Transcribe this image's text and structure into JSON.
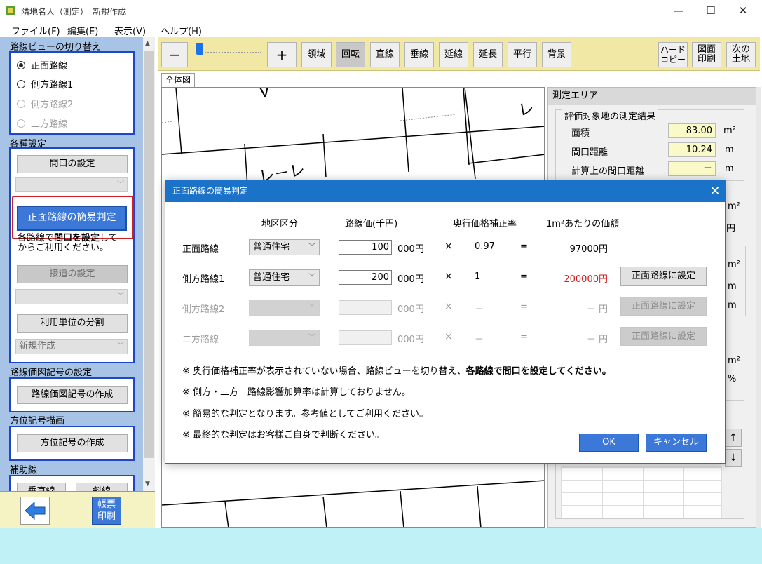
{
  "window": {
    "title": "隣地名人（測定）　新規作成",
    "minimize_icon": "—",
    "maximize_icon": "☐",
    "close_icon": "✕"
  },
  "menu": [
    "ファイル(F)",
    "編集(E)",
    "表示(V)",
    "ヘルプ(H)"
  ],
  "left_panel": {
    "route_view_title": "路線ビューの切り替え",
    "route_options": [
      {
        "label": "正面路線",
        "selected": true,
        "enabled": true
      },
      {
        "label": "側方路線1",
        "selected": false,
        "enabled": true
      },
      {
        "label": "側方路線2",
        "selected": false,
        "enabled": false
      },
      {
        "label": "二方路線",
        "selected": false,
        "enabled": false
      }
    ],
    "settings_title": "各種設定",
    "frontage_button": "間口の設定",
    "simple_judge_button": "正面路線の簡易判定",
    "hint_line1_pre": "各路線で",
    "hint_line1_bold": "間口を設定",
    "hint_line1_post": "して",
    "hint_line2": "からご利用ください。",
    "road_contact_button": "接道の設定",
    "unit_split_button": "利用単位の分割",
    "new_create_value": "新規作成",
    "route_price_title": "路線価図記号の設定",
    "route_price_button": "路線価図記号の作成",
    "direction_title": "方位記号描画",
    "direction_button": "方位記号の作成",
    "aux_title": "補助線",
    "aux_btn1": "垂直線",
    "aux_btn2": "斜線",
    "report_line1": "帳票",
    "report_line2": "印刷"
  },
  "toolbar": {
    "minus": "−",
    "plus": "+",
    "buttons": [
      "領域",
      "回転",
      "直線",
      "垂線",
      "延線",
      "延長",
      "平行",
      "背景"
    ],
    "hardcopy_l1": "ハード",
    "hardcopy_l2": "コピー",
    "print_l1": "図面",
    "print_l2": "印刷",
    "next_l1": "次の",
    "next_l2": "土地"
  },
  "tab": {
    "label": "全体図"
  },
  "canvas_labels": {
    "a": "V",
    "b": "レ",
    "c": "レ－レ"
  },
  "right_panel": {
    "header": "測定エリア",
    "group": "評価対象地の測定結果",
    "rows": [
      {
        "label": "面積",
        "value": "83.00",
        "unit": "m²"
      },
      {
        "label": "間口距離",
        "value": "10.24",
        "unit": "m"
      },
      {
        "label": "計算上の間口距離",
        "value": "－",
        "unit": "m"
      }
    ],
    "arrow_up": "↑",
    "arrow_down": "↓",
    "partial_units": [
      "m",
      "m²",
      "円",
      "m²",
      "m",
      "m",
      "m²",
      "%"
    ]
  },
  "modal": {
    "title": "正面路線の簡易判定",
    "close": "✕",
    "headers": {
      "district": "地区区分",
      "route_price": "路線価(千円)",
      "depth_coef": "奥行価格補正率",
      "per_sqm": "1m²あたりの価額"
    },
    "rows": [
      {
        "label": "正面路線",
        "district": "普通住宅",
        "price": "100",
        "unit": "000円",
        "times": "×",
        "coef": "0.97",
        "eq": "=",
        "result": "97000円",
        "set_button": ""
      },
      {
        "label": "側方路線1",
        "district": "普通住宅",
        "price": "200",
        "unit": "000円",
        "times": "×",
        "coef": "1",
        "eq": "=",
        "result": "200000円",
        "set_button": "正面路線に設定"
      },
      {
        "label": "側方路線2",
        "district": "",
        "price": "",
        "unit": "000円",
        "times": "×",
        "coef": "－",
        "eq": "=",
        "result": "－ 円",
        "set_button": "正面路線に設定"
      },
      {
        "label": "二方路線",
        "district": "",
        "price": "",
        "unit": "000円",
        "times": "×",
        "coef": "－",
        "eq": "=",
        "result": "－ 円",
        "set_button": "正面路線に設定"
      }
    ],
    "notes": {
      "n1_pre": "※  奥行価格補正率が表示されていない場合、路線ビューを切り替え、",
      "n1_bold": "各路線で間口を設定してください。",
      "n2": "※  側方・二方　路線影響加算率は計算しておりません。",
      "n3": "※  簡易的な判定となります。参考値としてご利用ください。",
      "n4": "※  最終的な判定はお客様ご自身で判断ください。"
    },
    "ok": "OK",
    "cancel": "キャンセル"
  },
  "colors": {
    "accent": "#1a73c8",
    "highlight_red": "#cc1f1f",
    "left_panel": "#a7c4e6",
    "toolbar": "#f1e8a6"
  }
}
